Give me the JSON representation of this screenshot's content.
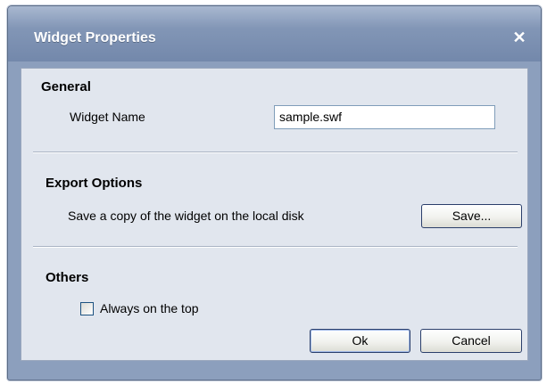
{
  "dialog": {
    "title": "Widget Properties",
    "close_glyph": "✕"
  },
  "general": {
    "heading": "General",
    "widget_name_label": "Widget Name",
    "widget_name_value": "sample.swf"
  },
  "export": {
    "heading": "Export Options",
    "description": "Save a copy of the widget on the local disk",
    "save_button": "Save..."
  },
  "others": {
    "heading": "Others",
    "always_on_top_label": "Always on the top",
    "always_on_top_checked": false
  },
  "footer": {
    "ok_button": "Ok",
    "cancel_button": "Cancel"
  },
  "colors": {
    "titlebar": "#8296b6",
    "panel": "#e1e6ee",
    "frame": "#8c9fbd"
  }
}
